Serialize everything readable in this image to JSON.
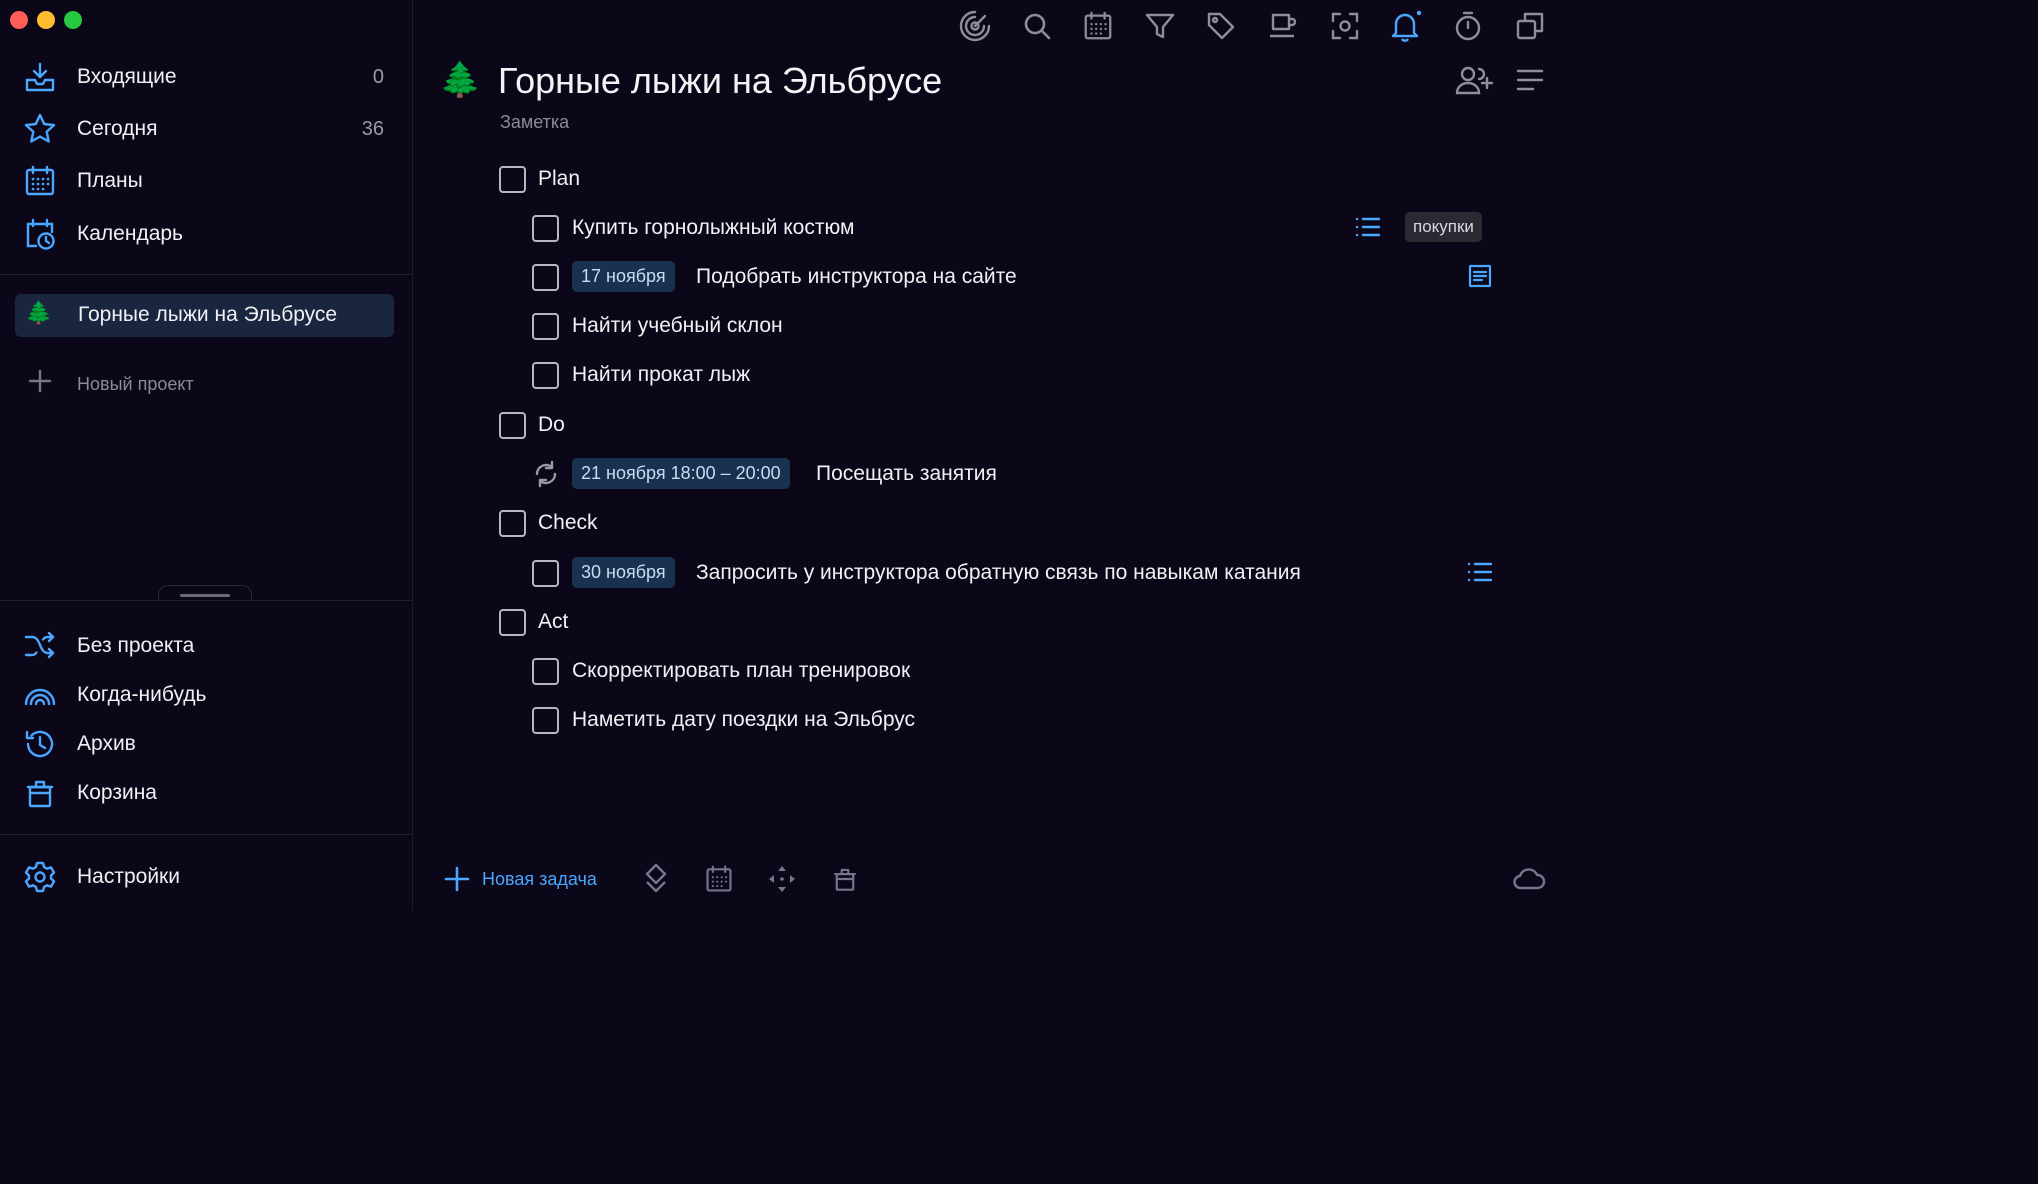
{
  "colors": {
    "accent": "#4aa6ff",
    "background": "#0b0719",
    "selected": "#1a2640",
    "date_chip": "#18324f",
    "tag_chip": "#2b2a33"
  },
  "window": {
    "controls": [
      "close",
      "minimize",
      "zoom"
    ]
  },
  "sidebar": {
    "top_items": [
      {
        "label": "Входящие",
        "count": "0",
        "icon": "inbox-icon"
      },
      {
        "label": "Сегодня",
        "count": "36",
        "icon": "star-icon"
      },
      {
        "label": "Планы",
        "count": "",
        "icon": "calendar-grid-icon"
      },
      {
        "label": "Календарь",
        "count": "",
        "icon": "calendar-clock-icon"
      }
    ],
    "projects": [
      {
        "emoji": "🌲",
        "label": "Горные лыжи на Эльбрусе",
        "selected": true
      }
    ],
    "new_project_label": "Новый проект",
    "bottom_items": [
      {
        "label": "Без проекта",
        "icon": "shuffle-icon"
      },
      {
        "label": "Когда-нибудь",
        "icon": "rainbow-icon"
      },
      {
        "label": "Архив",
        "icon": "history-icon"
      },
      {
        "label": "Корзина",
        "icon": "trash-icon"
      }
    ],
    "settings_label": "Настройки"
  },
  "toolbar": {
    "icons": [
      "target-icon",
      "search-icon",
      "calendar-icon",
      "filter-icon",
      "tag-icon",
      "coffee-icon",
      "focus-icon",
      "bell-icon",
      "timer-icon",
      "copy-icon"
    ],
    "active": "bell-icon"
  },
  "project": {
    "emoji": "🌲",
    "title": "Горные лыжи на Эльбрусе",
    "subtitle": "Заметка",
    "header_icons": [
      "add-user-icon",
      "menu-icon"
    ]
  },
  "tasks": {
    "plan": {
      "heading": "Plan",
      "items": [
        {
          "text": "Купить горнолыжный костюм",
          "date": "",
          "tag": "покупки",
          "icon": "checklist-icon"
        },
        {
          "text": "Подобрать инструктора на сайте",
          "date": "17 ноября",
          "tag": "",
          "icon": "note-icon"
        },
        {
          "text": "Найти учебный склон",
          "date": "",
          "tag": "",
          "icon": ""
        },
        {
          "text": "Найти прокат лыж",
          "date": "",
          "tag": "",
          "icon": ""
        }
      ]
    },
    "do": {
      "heading": "Do",
      "items": [
        {
          "text": "Посещать занятия",
          "date": "21 ноября 18:00 – 20:00",
          "repeat": true
        }
      ]
    },
    "check": {
      "heading": "Check",
      "items": [
        {
          "text": "Запросить у инструктора обратную связь по навыкам катания",
          "date": "30 ноября",
          "icon": "checklist-icon"
        }
      ]
    },
    "act": {
      "heading": "Act",
      "items": [
        {
          "text": "Скорректировать план тренировок"
        },
        {
          "text": "Наметить дату поездки на Эльбрус"
        }
      ]
    }
  },
  "bottom_bar": {
    "new_task_label": "Новая задача",
    "icons": [
      "priority-icon",
      "calendar-icon",
      "move-icon",
      "trash-icon",
      "cloud-icon"
    ]
  }
}
